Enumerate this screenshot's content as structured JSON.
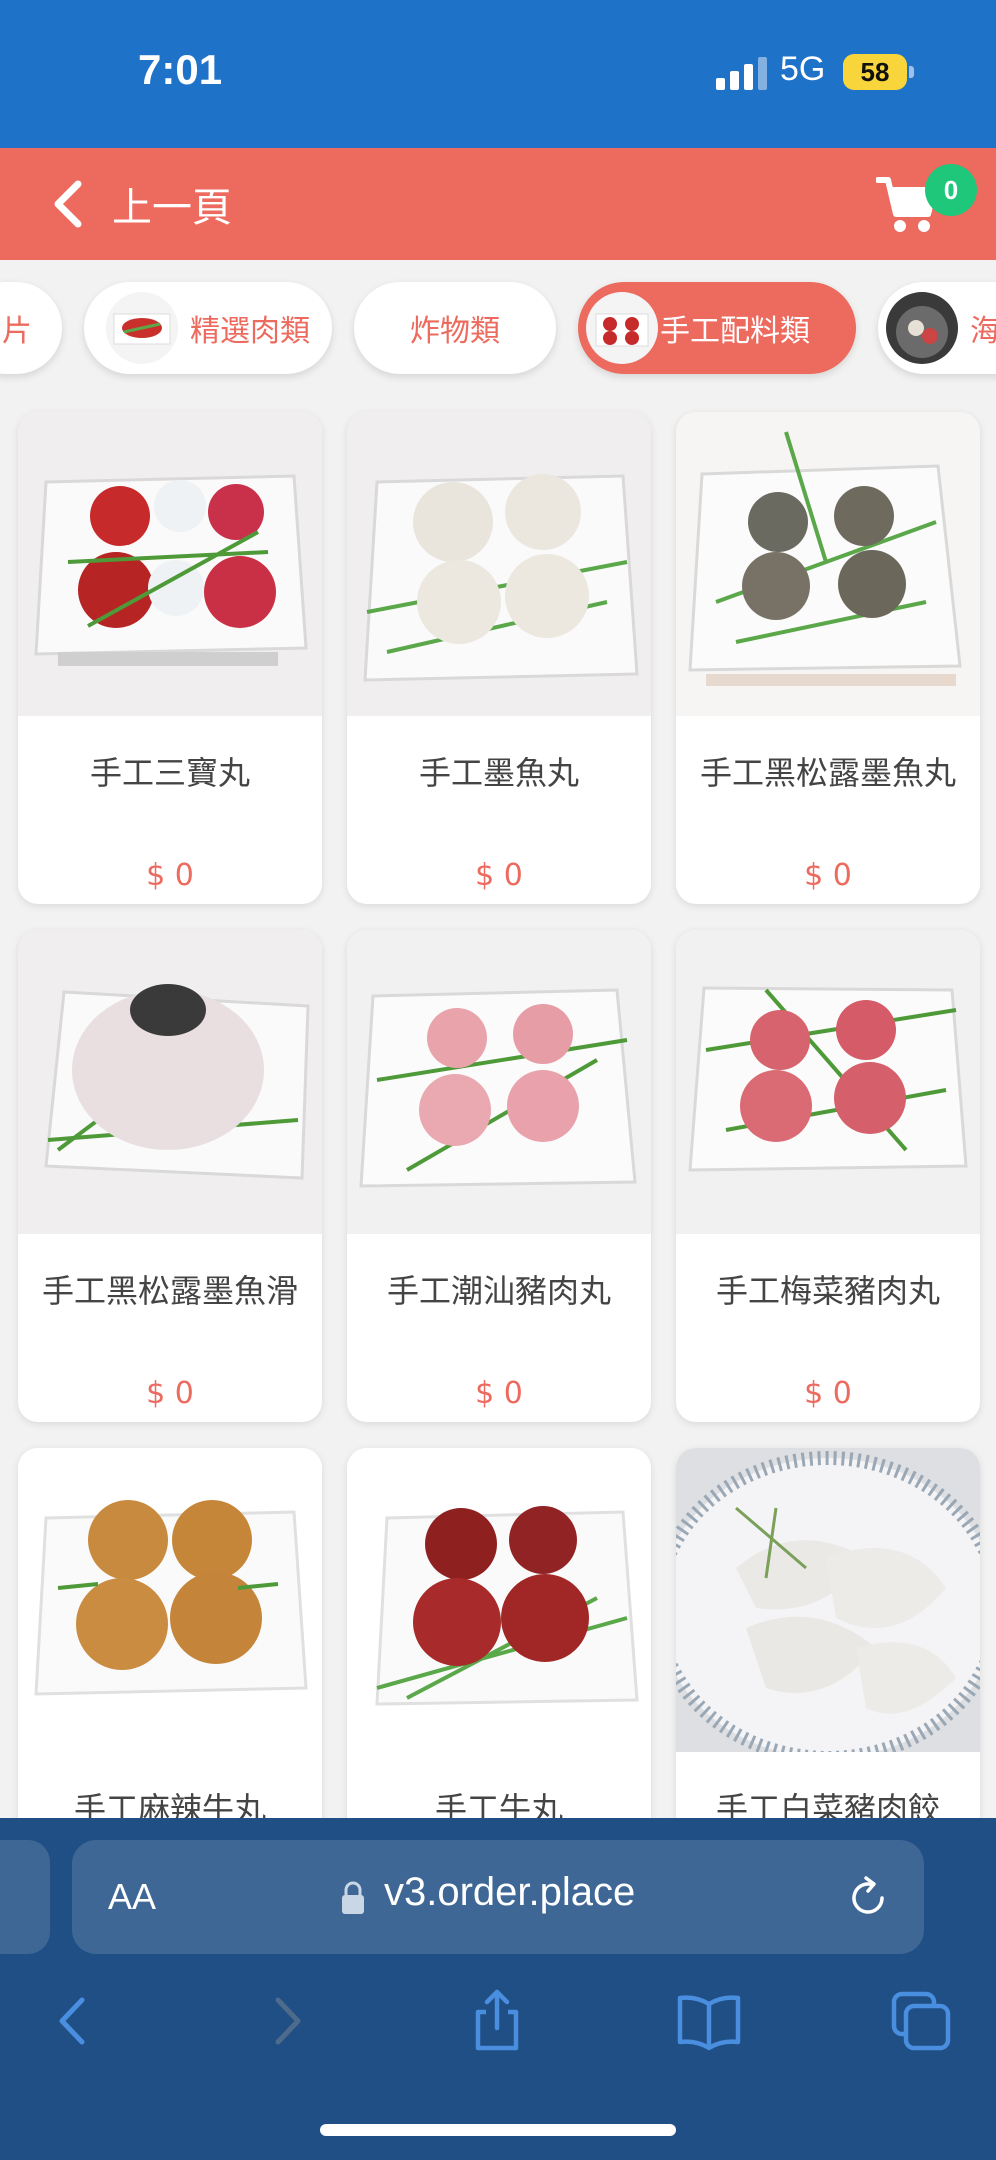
{
  "status_bar": {
    "time": "7:01",
    "network": "5G",
    "battery": "58"
  },
  "header": {
    "back_label": "上一頁",
    "cart_count": "0"
  },
  "categories": [
    {
      "label": "片",
      "active": false
    },
    {
      "label": "精選肉類",
      "active": false
    },
    {
      "label": "炸物類",
      "active": false
    },
    {
      "label": "手工配料類",
      "active": true
    },
    {
      "label": "海",
      "active": false
    }
  ],
  "products": [
    {
      "name": "手工三寶丸",
      "price": "$ 0"
    },
    {
      "name": "手工墨魚丸",
      "price": "$ 0"
    },
    {
      "name": "手工黑松露墨魚丸",
      "price": "$ 0"
    },
    {
      "name": "手工黑松露墨魚滑",
      "price": "$ 0"
    },
    {
      "name": "手工潮汕豬肉丸",
      "price": "$ 0"
    },
    {
      "name": "手工梅菜豬肉丸",
      "price": "$ 0"
    },
    {
      "name": "手工麻辣牛丸",
      "price": ""
    },
    {
      "name": "手工牛丸",
      "price": ""
    },
    {
      "name": "手工白菜豬肉餃",
      "price": ""
    }
  ],
  "browser": {
    "aa_label": "AA",
    "url": "v3.order.place"
  },
  "icons": {
    "back": "chevron-left-icon",
    "cart": "shopping-cart-icon",
    "lock": "lock-icon",
    "reload": "reload-icon",
    "nav_back": "chevron-left-icon",
    "nav_forward": "chevron-right-icon",
    "share": "share-icon",
    "bookmarks": "book-icon",
    "tabs": "tabs-icon"
  },
  "colors": {
    "status_bar": "#1e72c8",
    "header": "#ec6a5e",
    "accent": "#ec6a5e",
    "badge": "#1ec77a",
    "browser_bar": "#1f4f84"
  }
}
